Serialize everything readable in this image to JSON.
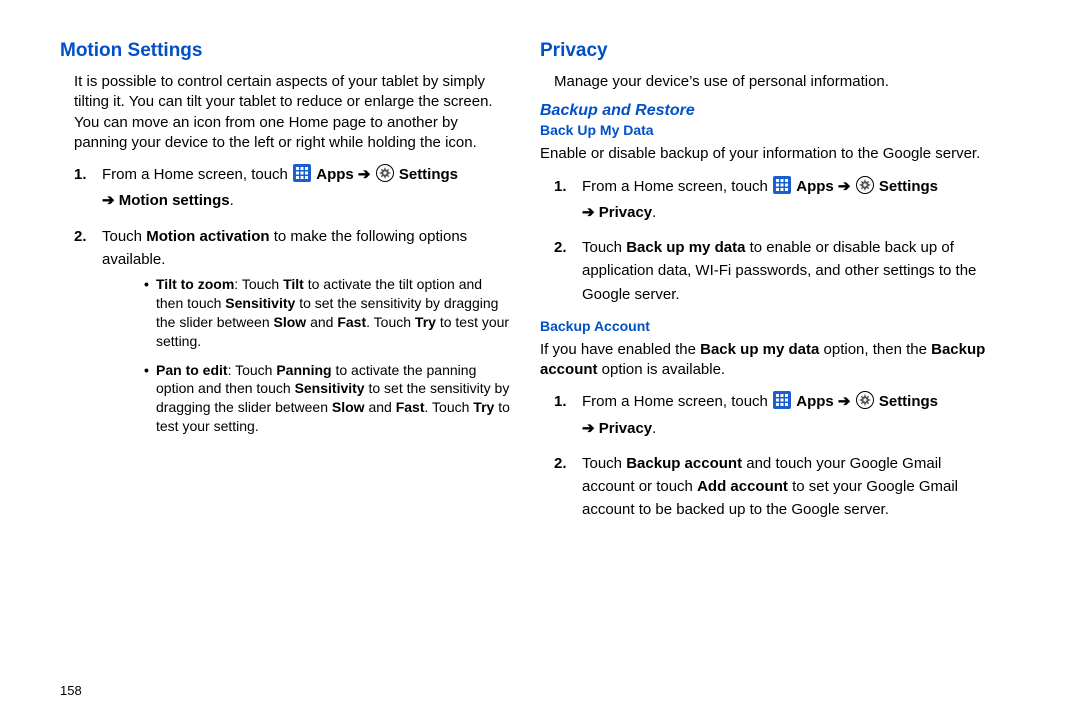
{
  "left": {
    "h2": "Motion Settings",
    "intro": "It is possible to control certain aspects of your tablet by simply tilting it. You can tilt your tablet to reduce or enlarge the screen. You can move an icon from one Home page to another by panning your device to the left or right while holding the icon.",
    "step1_a": "From a Home screen, touch ",
    "step1_apps": " Apps ",
    "step1_arrow": "➔ ",
    "step1_settings": " Settings",
    "step1_line2_arrow": "➔ ",
    "step1_line2_rest": "Motion settings",
    "step1_period": ".",
    "step2_a": "Touch ",
    "step2_b": "Motion activation",
    "step2_c": " to make the following options available.",
    "bullet1_tilt": "Tilt to zoom",
    "bullet1_a": ": Touch ",
    "bullet1_tilt2": "Tilt",
    "bullet1_b": " to activate the tilt option and then touch ",
    "bullet1_sens": "Sensitivity",
    "bullet1_c": " to set the sensitivity by dragging the slider between ",
    "bullet1_slow": "Slow",
    "bullet1_and": " and ",
    "bullet1_fast": "Fast",
    "bullet1_d": ". Touch ",
    "bullet1_try": "Try",
    "bullet1_e": " to test your setting.",
    "bullet2_pan": "Pan to edit",
    "bullet2_a": ": Touch ",
    "bullet2_panning": "Panning",
    "bullet2_b": " to activate the panning option and then touch ",
    "bullet2_sens": "Sensitivity",
    "bullet2_c": " to set the sensitivity by dragging the slider between ",
    "bullet2_slow": "Slow",
    "bullet2_and": " and ",
    "bullet2_fast": "Fast",
    "bullet2_d": ". Touch ",
    "bullet2_try": "Try",
    "bullet2_e": " to test your setting."
  },
  "right": {
    "h2": "Privacy",
    "intro": "Manage your device’s use of personal information.",
    "h3_backup": "Backup and Restore",
    "h4_backup_data": "Back Up My Data",
    "backup_intro": "Enable or disable backup of your information to the Google server.",
    "step1_a": "From a Home screen, touch ",
    "step1_apps": " Apps ",
    "step1_arrow": "➔ ",
    "step1_settings": " Settings",
    "step1_line2_arrow": "➔ ",
    "step1_line2_rest": "Privacy",
    "step1_period": ".",
    "step2_a": "Touch ",
    "step2_b": "Back up my data",
    "step2_c": " to enable or disable back up of application data, WI-Fi passwords, and other settings to the Google server.",
    "h4_backup_acct": "Backup Account",
    "acct_intro_a": "If you have enabled the ",
    "acct_intro_b": "Back up my data",
    "acct_intro_c": " option, then the ",
    "acct_intro_d": "Backup account",
    "acct_intro_e": " option is available.",
    "astep1_a": "From a Home screen, touch ",
    "astep1_apps": " Apps ",
    "astep1_arrow": "➔ ",
    "astep1_settings": " Settings",
    "astep1_line2_arrow": "➔ ",
    "astep1_line2_rest": "Privacy",
    "astep1_period": ".",
    "astep2_a": "Touch ",
    "astep2_b": "Backup account",
    "astep2_c": " and touch your Google Gmail account or touch ",
    "astep2_d": "Add account",
    "astep2_e": " to set your Google Gmail account to be backed up to the Google server."
  },
  "pagenum": "158"
}
